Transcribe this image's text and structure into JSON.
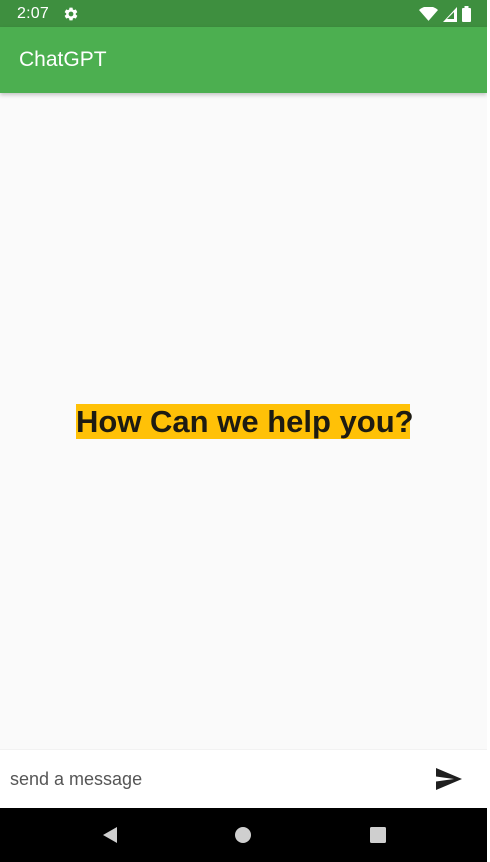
{
  "status_bar": {
    "time": "2:07",
    "icons": [
      "settings-icon",
      "wifi-icon",
      "signal-icon",
      "battery-icon"
    ]
  },
  "app_bar": {
    "title": "ChatGPT"
  },
  "content": {
    "headline": "How Can we help you?"
  },
  "composer": {
    "placeholder": "send a message",
    "send_icon": "send-icon"
  },
  "navigation": {
    "buttons": [
      "back-icon",
      "home-icon",
      "recents-icon"
    ]
  },
  "colors": {
    "status_bar": "#3e8f3f",
    "app_bar": "#4caf50",
    "background": "#fafafa",
    "headline_highlight": "#ffc107",
    "headline_text": "#1d1b12",
    "nav_bar": "#000000"
  }
}
